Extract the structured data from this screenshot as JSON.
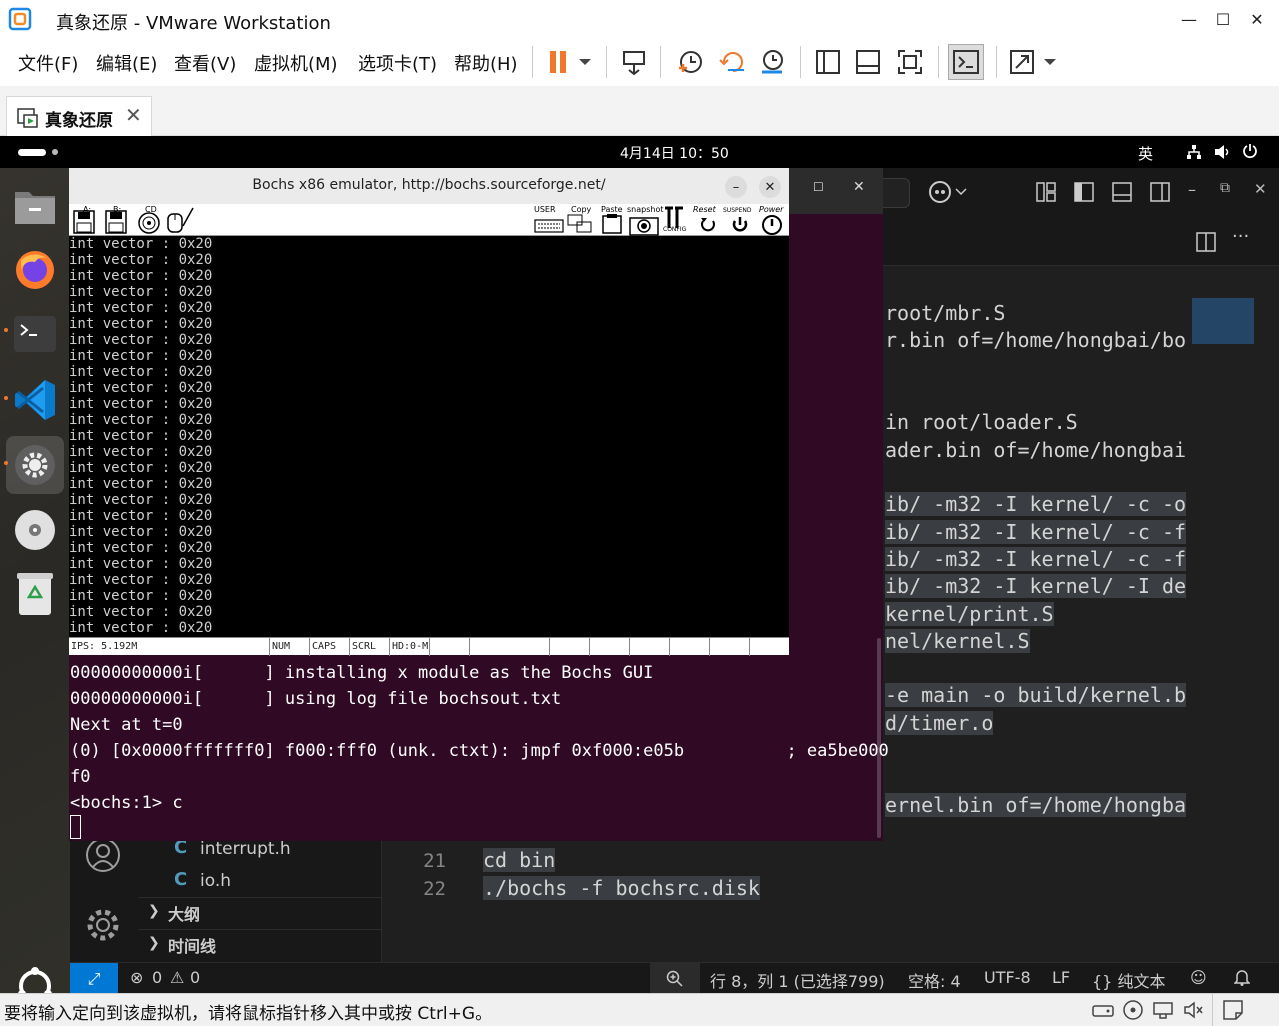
{
  "host": {
    "title": "真象还原 - VMware Workstation",
    "menu": [
      "文件(F)",
      "编辑(E)",
      "查看(V)",
      "虚拟机(M)",
      "选项卡(T)",
      "帮助(H)"
    ],
    "toolbar_icons": [
      "pause-icon",
      "dropdown-icon",
      "send-ctrl-alt-del-icon",
      "snapshot-icon",
      "revert-snapshot-icon",
      "snapshot-manager-icon",
      "sidebar-icon",
      "thumbnail-icon",
      "fullscreen-icon",
      "console-view-icon",
      "stretch-icon",
      "dropdown-icon"
    ],
    "tab_label": "真象还原",
    "status_message": "要将输入定向到该虚拟机，请将鼠标指针移入其中或按 Ctrl+G。"
  },
  "guest": {
    "clock": "4月14日  10：50",
    "input_lang": "英",
    "dock_items": [
      "files-icon",
      "firefox-icon",
      "terminal-icon",
      "vscode-icon",
      "settings-icon",
      "dvd-icon",
      "trash-icon",
      "ubuntu-apps-icon"
    ]
  },
  "vscode": {
    "editor_lines": [
      {
        "text": "root/mbr.S"
      },
      {
        "text": "r.bin of=/home/hongbai/bo"
      },
      {
        "text": ""
      },
      {
        "text": ""
      },
      {
        "text": "in root/loader.S"
      },
      {
        "text": "ader.bin of=/home/hongbai"
      },
      {
        "text": ""
      },
      {
        "text": "ib/ -m32 -I kernel/ -c -o"
      },
      {
        "text": "ib/ -m32 -I kernel/ -c -f"
      },
      {
        "text": "ib/ -m32 -I kernel/ -c -f"
      },
      {
        "text": "ib/ -m32 -I kernel/ -I de"
      },
      {
        "text": "kernel/print.S"
      },
      {
        "text": "nel/kernel.S"
      },
      {
        "text": ""
      },
      {
        "text": "-e main -o build/kernel.b"
      },
      {
        "text": "d/timer.o"
      },
      {
        "text": ""
      },
      {
        "text": ""
      },
      {
        "text": "ernel.bin of=/home/hongba"
      }
    ],
    "numbered_lines": [
      {
        "num": "21",
        "text": "cd bin"
      },
      {
        "num": "22",
        "text": "./bochs -f bochsrc.disk"
      }
    ],
    "explorer_files": [
      {
        "icon": "C",
        "name": "interrupt.h"
      },
      {
        "icon": "C",
        "name": "io.h"
      }
    ],
    "outline_label": "大纲",
    "timeline_label": "时间线",
    "status": {
      "errors": "0",
      "warnings": "0",
      "position": "行 8，列 1 (已选择799)",
      "spaces": "空格: 4",
      "encoding": "UTF-8",
      "eol": "LF",
      "language": "{} 纯文本"
    }
  },
  "terminal": {
    "lines": [
      "00000000000i[      ] installing x module as the Bochs GUI",
      "00000000000i[      ] using log file bochsout.txt",
      "Next at t=0",
      "(0) [0x0000fffffff0] f000:fff0 (unk. ctxt): jmpf 0xf000:e05b          ; ea5be000",
      "f0",
      "<bochs:1> c"
    ]
  },
  "bochs": {
    "title": "Bochs x86 emulator, http://bochs.sourceforge.net/",
    "toolbar_labels": {
      "a": "A:",
      "b": "B:",
      "cd": "CD",
      "user": "USER",
      "copy": "Copy",
      "paste": "Paste",
      "snapshot": "snapshot",
      "config": "CONFIG",
      "reset": "Reset",
      "suspend": "SUSPEND",
      "power": "Power"
    },
    "screen_line": "int vector : 0x20",
    "screen_lines_count": 25,
    "status": {
      "ips": "IPS: 5.192M",
      "num": "NUM",
      "caps": "CAPS",
      "scrl": "SCRL",
      "hd": "HD:0-M"
    }
  }
}
